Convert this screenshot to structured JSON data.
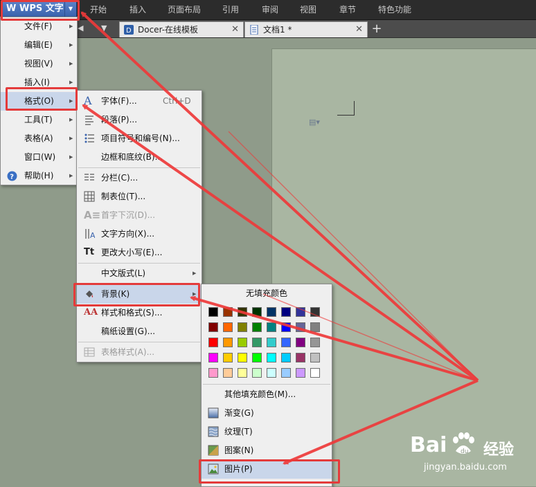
{
  "app": {
    "title": "WPS 文字"
  },
  "menubar": {
    "tabs": [
      "开始",
      "插入",
      "页面布局",
      "引用",
      "审阅",
      "视图",
      "章节",
      "特色功能"
    ]
  },
  "doc_tabs": [
    {
      "label": "Docer-在线模板"
    },
    {
      "label": "文档1 *"
    }
  ],
  "main_menu": {
    "items": [
      {
        "label": "文件(F)"
      },
      {
        "label": "编辑(E)"
      },
      {
        "label": "视图(V)"
      },
      {
        "label": "插入(I)"
      },
      {
        "label": "格式(O)"
      },
      {
        "label": "工具(T)"
      },
      {
        "label": "表格(A)"
      },
      {
        "label": "窗口(W)"
      },
      {
        "label": "帮助(H)"
      }
    ]
  },
  "format_menu": {
    "items": [
      {
        "label": "字体(F)...",
        "shortcut": "Ctrl+D"
      },
      {
        "label": "段落(P)..."
      },
      {
        "label": "项目符号和编号(N)..."
      },
      {
        "label": "边框和底纹(B)..."
      },
      {
        "label": "分栏(C)..."
      },
      {
        "label": "制表位(T)..."
      },
      {
        "label": "首字下沉(D)..."
      },
      {
        "label": "文字方向(X)..."
      },
      {
        "label": "更改大小写(E)..."
      },
      {
        "label": "中文版式(L)"
      },
      {
        "label": "背景(K)"
      },
      {
        "label": "样式和格式(S)..."
      },
      {
        "label": "稿纸设置(G)..."
      },
      {
        "label": "表格样式(A)..."
      }
    ]
  },
  "background_menu": {
    "no_fill": "无填充颜色",
    "colors": [
      [
        "#000000",
        "#993300",
        "#333300",
        "#003300",
        "#003366",
        "#000080",
        "#333399",
        "#333333"
      ],
      [
        "#800000",
        "#FF6600",
        "#808000",
        "#008000",
        "#008080",
        "#0000FF",
        "#666699",
        "#808080"
      ],
      [
        "#FF0000",
        "#FF9900",
        "#99CC00",
        "#339966",
        "#33CCCC",
        "#3366FF",
        "#800080",
        "#969696"
      ],
      [
        "#FF00FF",
        "#FFCC00",
        "#FFFF00",
        "#00FF00",
        "#00FFFF",
        "#00CCFF",
        "#993366",
        "#C0C0C0"
      ],
      [
        "#FF99CC",
        "#FFCC99",
        "#FFFF99",
        "#CCFFCC",
        "#CCFFFF",
        "#99CCFF",
        "#CC99FF",
        "#FFFFFF"
      ]
    ],
    "more_colors": "其他填充颜色(M)...",
    "items": [
      {
        "label": "渐变(G)"
      },
      {
        "label": "纹理(T)"
      },
      {
        "label": "图案(N)"
      },
      {
        "label": "图片(P)"
      }
    ]
  },
  "watermark": {
    "brand_a": "Bai",
    "brand_b": "经验",
    "url": "jingyan.baidu.com"
  }
}
